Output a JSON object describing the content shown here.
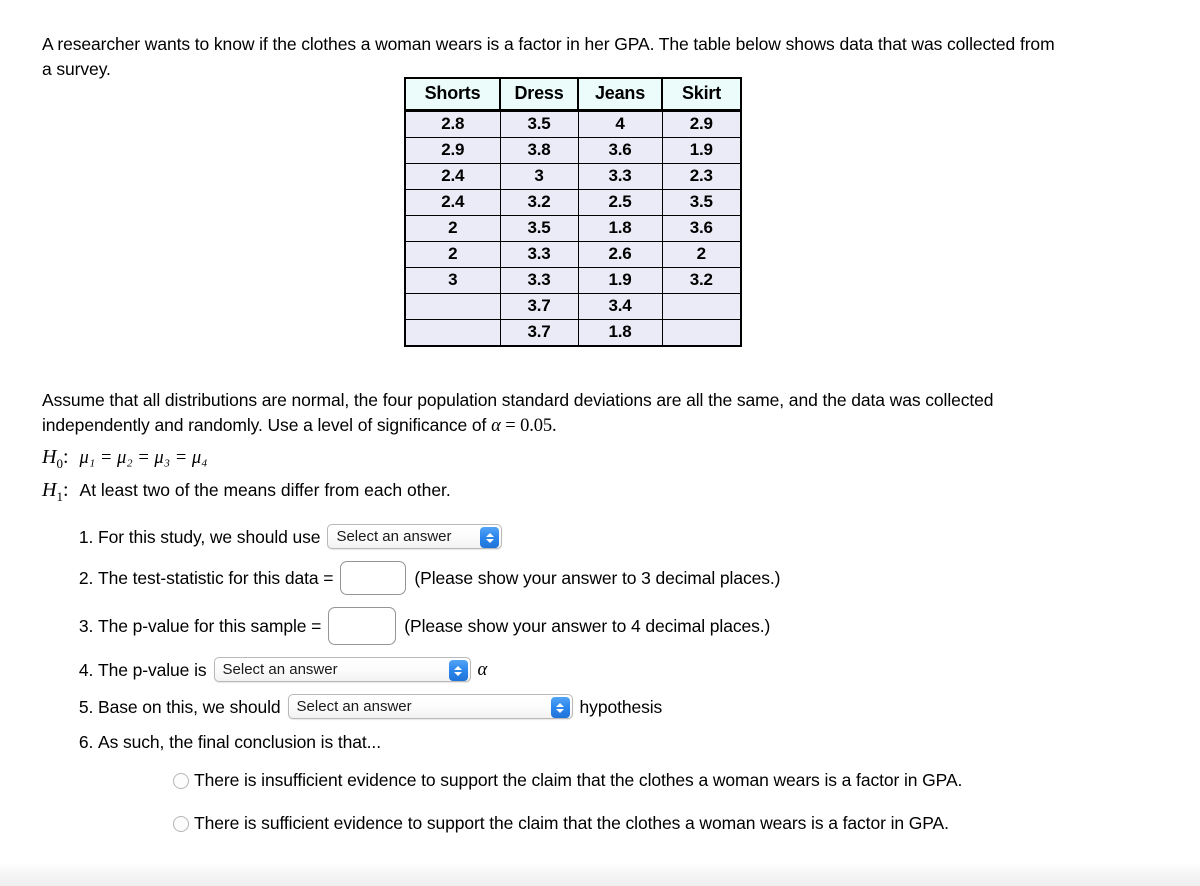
{
  "intro": {
    "text": "A researcher wants to know if the clothes a woman wears is a factor in her GPA. The table below shows data that was collected from a survey."
  },
  "table": {
    "headers": [
      "Shorts",
      "Dress",
      "Jeans",
      "Skirt"
    ],
    "rows": [
      [
        "2.8",
        "3.5",
        "4",
        "2.9"
      ],
      [
        "2.9",
        "3.8",
        "3.6",
        "1.9"
      ],
      [
        "2.4",
        "3",
        "3.3",
        "2.3"
      ],
      [
        "2.4",
        "3.2",
        "2.5",
        "3.5"
      ],
      [
        "2",
        "3.5",
        "1.8",
        "3.6"
      ],
      [
        "2",
        "3.3",
        "2.6",
        "2"
      ],
      [
        "3",
        "3.3",
        "1.9",
        "3.2"
      ],
      [
        "",
        "3.7",
        "3.4",
        ""
      ],
      [
        "",
        "3.7",
        "1.8",
        ""
      ]
    ]
  },
  "assumption": {
    "part1": "Assume that all distributions are normal, the four population standard deviations are all the same, and the data was collected independently and randomly. Use a level of significance of ",
    "alpha": "α",
    "equals": " = ",
    "alpha_value": "0.05."
  },
  "hypotheses": {
    "null_label": "H",
    "null_sub": "0",
    "null_colon": ":",
    "null_statement": "μ₁ = μ₂ = μ₃ = μ₄",
    "alt_label": "H",
    "alt_sub": "1",
    "alt_colon": ":",
    "alt_statement": "At least two of the means differ from each other."
  },
  "steps": {
    "s1": {
      "prefix": "For this study, we should use",
      "select_value": "Select an answer"
    },
    "s2": {
      "prefix": "The test-statistic for this data =",
      "input_value": "",
      "hint": "(Please show your answer to 3 decimal places.)"
    },
    "s3": {
      "prefix": "The p-value for this sample =",
      "input_value": "",
      "hint": "(Please show your answer to 4 decimal places.)"
    },
    "s4": {
      "prefix": "The p-value is",
      "select_value": "Select an answer",
      "suffix": "α"
    },
    "s5": {
      "prefix": "Base on this, we should",
      "select_value": "Select an answer",
      "suffix": "hypothesis"
    },
    "s6": {
      "prefix": "As such, the final conclusion is that...",
      "choices": [
        "There is insufficient evidence to support the claim that the clothes a woman wears is a factor in GPA.",
        "There is sufficient evidence to support the claim that the clothes a woman wears is a factor in GPA."
      ]
    }
  },
  "colors": {
    "table_header_bg": "#ecfcfa",
    "table_cell_bg": "#ebebf7",
    "stepper_blue": "#2b86ec",
    "border_black": "#000000"
  }
}
